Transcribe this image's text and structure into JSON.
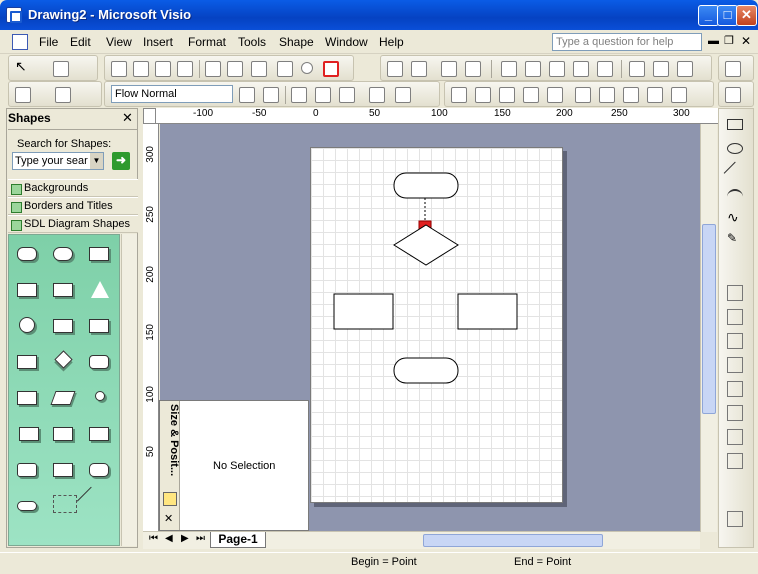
{
  "window": {
    "title": "Drawing2 - Microsoft Visio",
    "min": "_",
    "max": "□",
    "close": "✕"
  },
  "menu": [
    "File",
    "Edit",
    "View",
    "Insert",
    "Format",
    "Tools",
    "Shape",
    "Window",
    "Help"
  ],
  "help_box": {
    "placeholder": "Type a question for help"
  },
  "format_toolbar": {
    "style_value": "Flow Normal"
  },
  "shapes_panel": {
    "title": "Shapes",
    "close": "✕",
    "search_label": "Search for Shapes:",
    "search_value": "Type your sear",
    "go_icon": "arrow-right-icon",
    "stencils": [
      "Backgrounds",
      "Borders and Titles",
      "SDL Diagram Shapes"
    ]
  },
  "ruler": {
    "top_labels": [
      "-100",
      "-50",
      "0",
      "50",
      "100",
      "150",
      "200",
      "250",
      "300"
    ],
    "left_labels": [
      "300",
      "250",
      "200",
      "150",
      "100",
      "50"
    ]
  },
  "size_position": {
    "title": "Size & Posit...",
    "content": "No Selection"
  },
  "tabs": {
    "page": "Page-1"
  },
  "status": {
    "begin": "Begin = Point",
    "end": "End = Point"
  },
  "colors": {
    "titlebar": "#0a54dc",
    "canvas_bg": "#8e95ae",
    "stencil_bg": "#8fdcb8",
    "accent_red": "#e02020"
  }
}
